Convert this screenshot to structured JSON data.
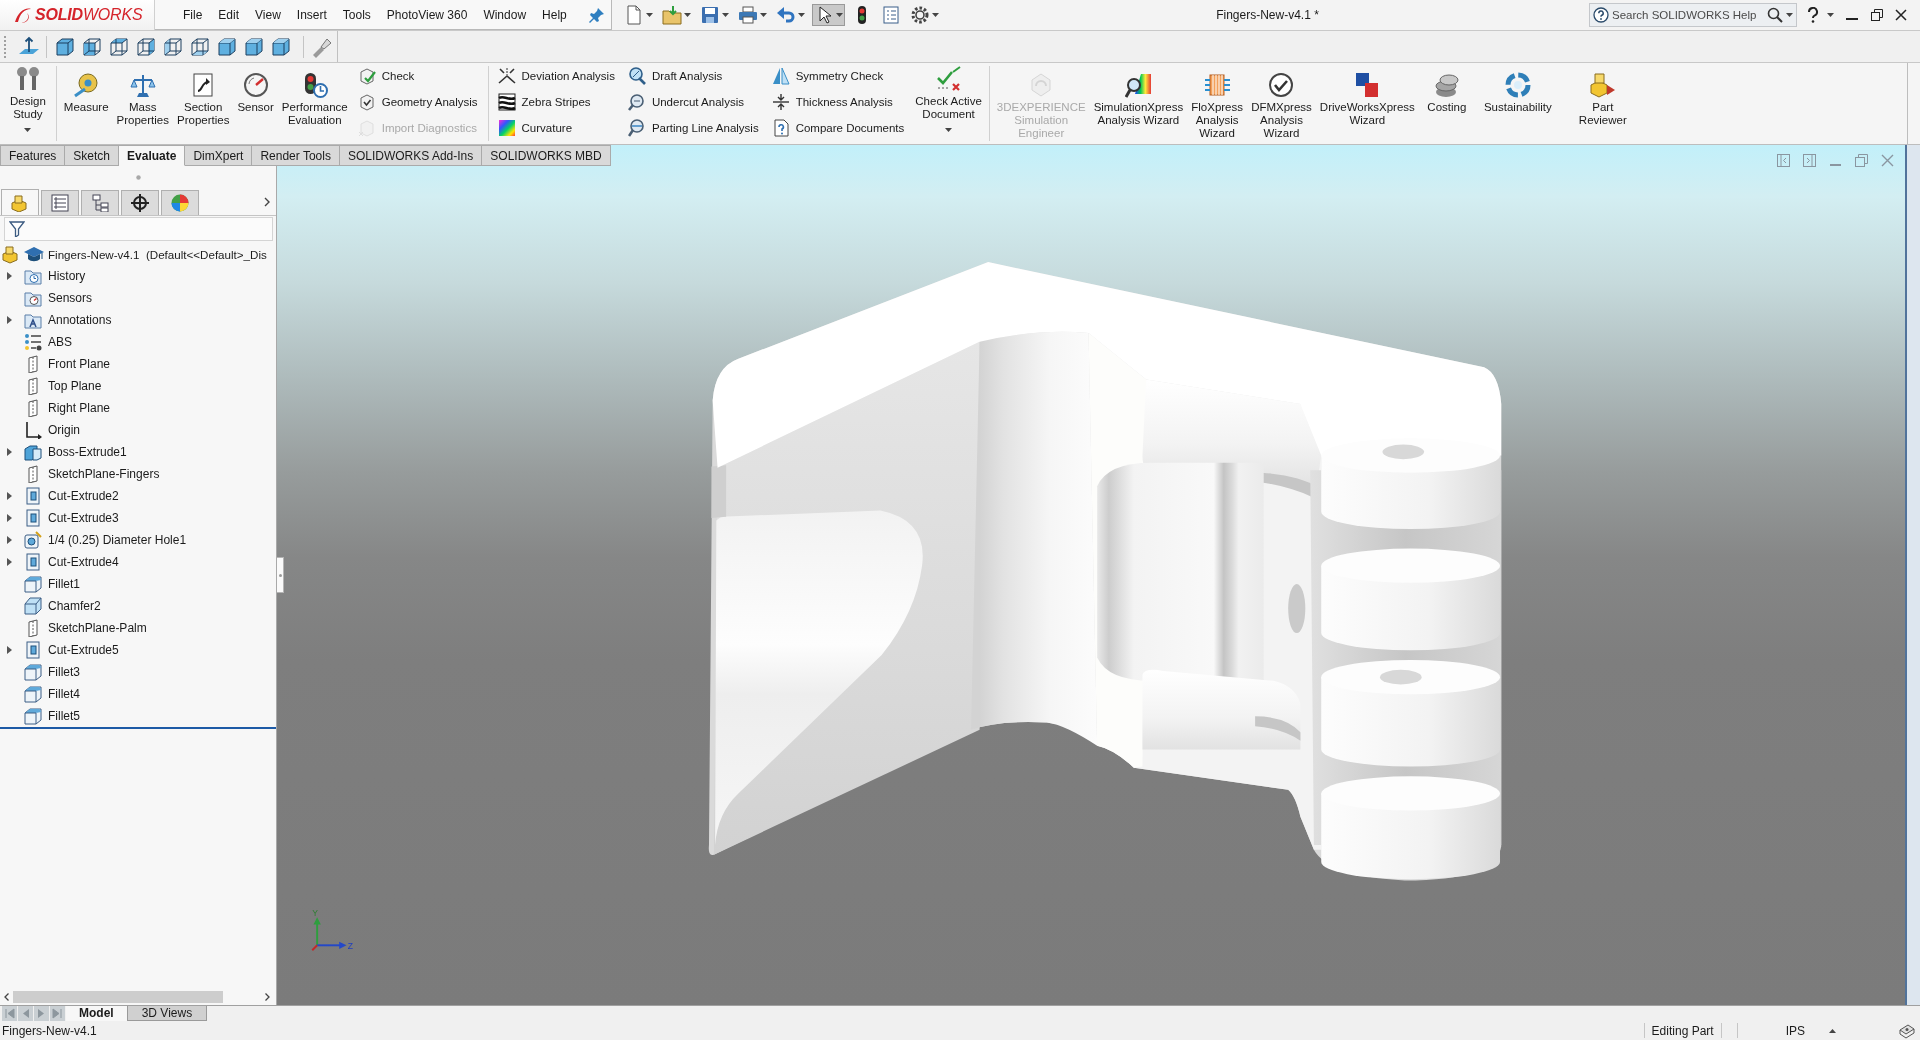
{
  "app": {
    "logo": "**SOLID**WORKS"
  },
  "menu": [
    "File",
    "Edit",
    "View",
    "Insert",
    "Tools",
    "PhotoView 360",
    "Window",
    "Help"
  ],
  "quick_access": [
    {
      "dropdown": true,
      "pressed": false
    },
    {
      "dropdown": true,
      "pressed": false
    },
    {
      "dropdown": true,
      "pressed": false
    },
    {
      "dropdown": true,
      "pressed": false
    },
    {
      "dropdown": true,
      "pressed": false
    },
    {
      "dropdown": true,
      "pressed": true
    },
    {
      "dropdown": false,
      "pressed": false
    },
    {
      "dropdown": false,
      "pressed": false
    },
    {
      "dropdown": true,
      "pressed": false
    }
  ],
  "window": {
    "title": "Fingers-New-v4.1 *"
  },
  "search": {
    "placeholder": "Search SOLIDWORKS Help"
  },
  "ribbon": {
    "sections": [
      {
        "groups": [
          {
            "kind": "large",
            "buttons": [
              {
                "label": "Design\nStudy",
                "dropdown": true,
                "disabled": false
              }
            ]
          }
        ]
      },
      {
        "groups": [
          {
            "kind": "large",
            "buttons": [
              {
                "label": "Measure",
                "dropdown": false,
                "disabled": false
              },
              {
                "label": "Mass\nProperties",
                "dropdown": false,
                "disabled": false
              },
              {
                "label": "Section\nProperties",
                "dropdown": false,
                "disabled": false
              },
              {
                "label": "Sensor",
                "dropdown": false,
                "disabled": false
              },
              {
                "label": "Performance\nEvaluation",
                "dropdown": false,
                "disabled": false
              }
            ]
          },
          {
            "kind": "small",
            "buttons": [
              {
                "label": "Check",
                "disabled": false
              },
              {
                "label": "Geometry Analysis",
                "disabled": false
              },
              {
                "label": "Import Diagnostics",
                "disabled": true
              }
            ]
          }
        ]
      },
      {
        "groups": [
          {
            "kind": "small",
            "buttons": [
              {
                "label": "Deviation Analysis",
                "disabled": false
              },
              {
                "label": "Zebra Stripes",
                "disabled": false
              },
              {
                "label": "Curvature",
                "disabled": false
              }
            ]
          },
          {
            "kind": "small",
            "buttons": [
              {
                "label": "Draft Analysis",
                "disabled": false
              },
              {
                "label": "Undercut Analysis",
                "disabled": false
              },
              {
                "label": "Parting Line Analysis",
                "disabled": false
              }
            ]
          },
          {
            "kind": "small",
            "buttons": [
              {
                "label": "Symmetry Check",
                "disabled": false
              },
              {
                "label": "Thickness Analysis",
                "disabled": false
              },
              {
                "label": "Compare Documents",
                "disabled": false
              }
            ]
          },
          {
            "kind": "large",
            "buttons": [
              {
                "label": "Check Active\nDocument",
                "dropdown": true,
                "disabled": false
              }
            ]
          }
        ]
      },
      {
        "groups": [
          {
            "kind": "large",
            "buttons": [
              {
                "label": "3DEXPERIENCE\nSimulation\nEngineer",
                "dropdown": false,
                "disabled": true
              },
              {
                "label": "SimulationXpress\nAnalysis Wizard",
                "dropdown": false,
                "disabled": false
              },
              {
                "label": "FloXpress\nAnalysis\nWizard",
                "dropdown": false,
                "disabled": false
              },
              {
                "label": "DFMXpress\nAnalysis\nWizard",
                "dropdown": false,
                "disabled": false
              },
              {
                "label": "DriveWorksXpress\nWizard",
                "dropdown": false,
                "disabled": false
              },
              {
                "label": "Costing",
                "dropdown": false,
                "disabled": false
              },
              {
                "label": "Sustainability",
                "dropdown": false,
                "disabled": false
              },
              {
                "label": "Part\nReviewer",
                "dropdown": false,
                "disabled": false
              }
            ]
          }
        ]
      }
    ]
  },
  "command_tabs": [
    {
      "label": "Features",
      "selected": false
    },
    {
      "label": "Sketch",
      "selected": false
    },
    {
      "label": "Evaluate",
      "selected": true
    },
    {
      "label": "DimXpert",
      "selected": false
    },
    {
      "label": "Render Tools",
      "selected": false
    },
    {
      "label": "SOLIDWORKS Add-Ins",
      "selected": false
    },
    {
      "label": "SOLIDWORKS MBD",
      "selected": false
    }
  ],
  "feature_manager": {
    "tabs": [
      {
        "selected": true
      },
      {
        "selected": false
      },
      {
        "selected": false
      },
      {
        "selected": false
      },
      {
        "selected": false
      }
    ],
    "root": {
      "label": "Fingers-New-v4.1  (Default<<Default>_Dis"
    },
    "items": [
      {
        "label": "History",
        "kind": "history",
        "expandable": true,
        "expanded": false
      },
      {
        "label": "Sensors",
        "kind": "sensors",
        "expandable": false,
        "expanded": false
      },
      {
        "label": "Annotations",
        "kind": "annotations",
        "expandable": true,
        "expanded": false
      },
      {
        "label": "ABS",
        "kind": "material",
        "expandable": false,
        "expanded": false
      },
      {
        "label": "Front Plane",
        "kind": "plane",
        "expandable": false,
        "expanded": false
      },
      {
        "label": "Top Plane",
        "kind": "plane",
        "expandable": false,
        "expanded": false
      },
      {
        "label": "Right Plane",
        "kind": "plane",
        "expandable": false,
        "expanded": false
      },
      {
        "label": "Origin",
        "kind": "origin",
        "expandable": false,
        "expanded": false
      },
      {
        "label": "Boss-Extrude1",
        "kind": "boss",
        "expandable": true,
        "expanded": false
      },
      {
        "label": "SketchPlane-Fingers",
        "kind": "plane",
        "expandable": false,
        "expanded": false
      },
      {
        "label": "Cut-Extrude2",
        "kind": "cut",
        "expandable": true,
        "expanded": false
      },
      {
        "label": "Cut-Extrude3",
        "kind": "cut",
        "expandable": true,
        "expanded": false
      },
      {
        "label": "1/4 (0.25) Diameter Hole1",
        "kind": "hole",
        "expandable": true,
        "expanded": false
      },
      {
        "label": "Cut-Extrude4",
        "kind": "cut",
        "expandable": true,
        "expanded": false
      },
      {
        "label": "Fillet1",
        "kind": "fillet",
        "expandable": false,
        "expanded": false
      },
      {
        "label": "Chamfer2",
        "kind": "chamfer",
        "expandable": false,
        "expanded": false
      },
      {
        "label": "SketchPlane-Palm",
        "kind": "plane",
        "expandable": false,
        "expanded": false
      },
      {
        "label": "Cut-Extrude5",
        "kind": "cut",
        "expandable": true,
        "expanded": false
      },
      {
        "label": "Fillet3",
        "kind": "fillet",
        "expandable": false,
        "expanded": false
      },
      {
        "label": "Fillet4",
        "kind": "fillet",
        "expandable": false,
        "expanded": false
      },
      {
        "label": "Fillet5",
        "kind": "fillet",
        "expandable": false,
        "expanded": false
      }
    ]
  },
  "viewport": {
    "triad": {
      "labels": [
        "Y",
        "Z"
      ]
    }
  },
  "bottom_tabs": [
    {
      "label": "Model",
      "selected": true
    },
    {
      "label": "3D Views",
      "selected": false
    }
  ],
  "status_bar": {
    "document": "Fingers-New-v4.1",
    "mode": "Editing Part",
    "units": "IPS"
  }
}
